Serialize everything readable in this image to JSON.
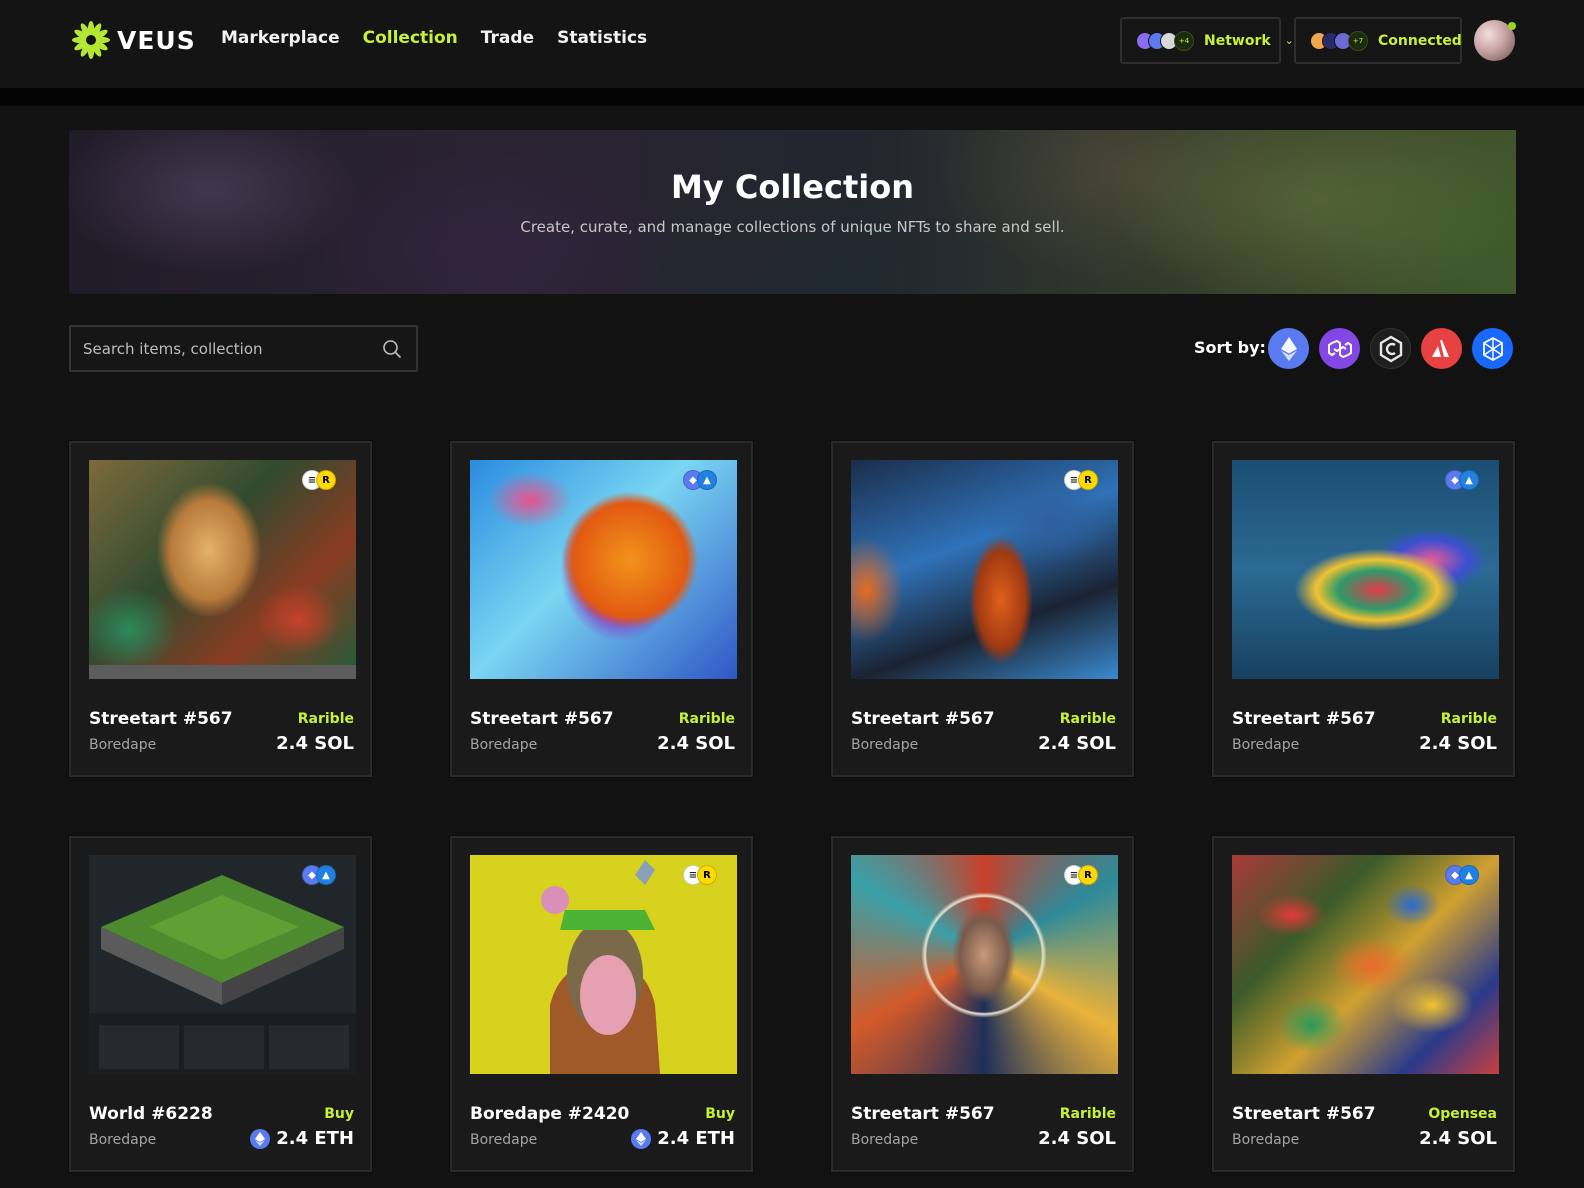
{
  "brand": {
    "name": "VEUS",
    "accent": "#c6f135"
  },
  "nav": [
    {
      "label": "Markerplace",
      "active": false
    },
    {
      "label": "Collection",
      "active": true
    },
    {
      "label": "Trade",
      "active": false
    },
    {
      "label": "Statistics",
      "active": false
    }
  ],
  "header": {
    "network": {
      "label": "Network",
      "more": "+4"
    },
    "wallet": {
      "label": "Connected",
      "more": "+7"
    }
  },
  "banner": {
    "title": "My Collection",
    "subtitle": "Create, curate, and manage collections of unique NFTs to share and sell."
  },
  "search": {
    "placeholder": "Search items, collection"
  },
  "sort": {
    "label": "Sort by:",
    "chains": [
      "ethereum-icon",
      "polygon-icon",
      "cronos-icon",
      "avalanche-icon",
      "fantom-icon"
    ]
  },
  "cards": [
    {
      "title": "Streetart #567",
      "market": "Rarible",
      "collection": "Boredape",
      "price": "2.4 SOL",
      "badge": "rarible",
      "eth": false
    },
    {
      "title": "Streetart #567",
      "market": "Rarible",
      "collection": "Boredape",
      "price": "2.4 SOL",
      "badge": "eth",
      "eth": false
    },
    {
      "title": "Streetart #567",
      "market": "Rarible",
      "collection": "Boredape",
      "price": "2.4 SOL",
      "badge": "rarible",
      "eth": false
    },
    {
      "title": "Streetart #567",
      "market": "Rarible",
      "collection": "Boredape",
      "price": "2.4 SOL",
      "badge": "eth",
      "eth": false
    },
    {
      "title": "World #6228",
      "market": "Buy",
      "collection": "Boredape",
      "price": "2.4 ETH",
      "badge": "eth",
      "eth": true
    },
    {
      "title": "Boredape #2420",
      "market": "Buy",
      "collection": "Boredape",
      "price": "2.4 ETH",
      "badge": "rarible",
      "eth": true
    },
    {
      "title": "Streetart #567",
      "market": "Rarible",
      "collection": "Boredape",
      "price": "2.4 SOL",
      "badge": "rarible",
      "eth": false
    },
    {
      "title": "Streetart #567",
      "market": "Opensea",
      "collection": "Boredape",
      "price": "2.4 SOL",
      "badge": "eth",
      "eth": false
    }
  ]
}
